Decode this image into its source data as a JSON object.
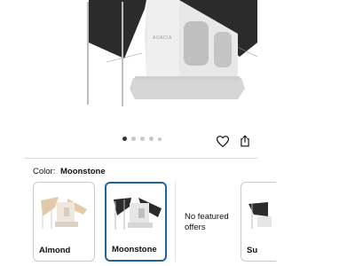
{
  "product": {
    "brand_logo": "AOACIA"
  },
  "carousel": {
    "total_dots": 5,
    "active_index": 0
  },
  "actions": {
    "favorite_icon": "heart-icon",
    "share_icon": "share-icon"
  },
  "variant": {
    "label": "Color:",
    "selected_value": "Moonstone",
    "options": [
      {
        "name": "Almond",
        "selected": false
      },
      {
        "name": "Moonstone",
        "selected": true
      },
      {
        "name": "Su",
        "selected": false
      }
    ],
    "no_featured_text": "No featured offers"
  },
  "colors": {
    "selected_border": "#2162a1",
    "awning_dark": "#2b2b2b",
    "tent_light": "#e6e6e6",
    "almond_tan": "#e5c9a6"
  }
}
